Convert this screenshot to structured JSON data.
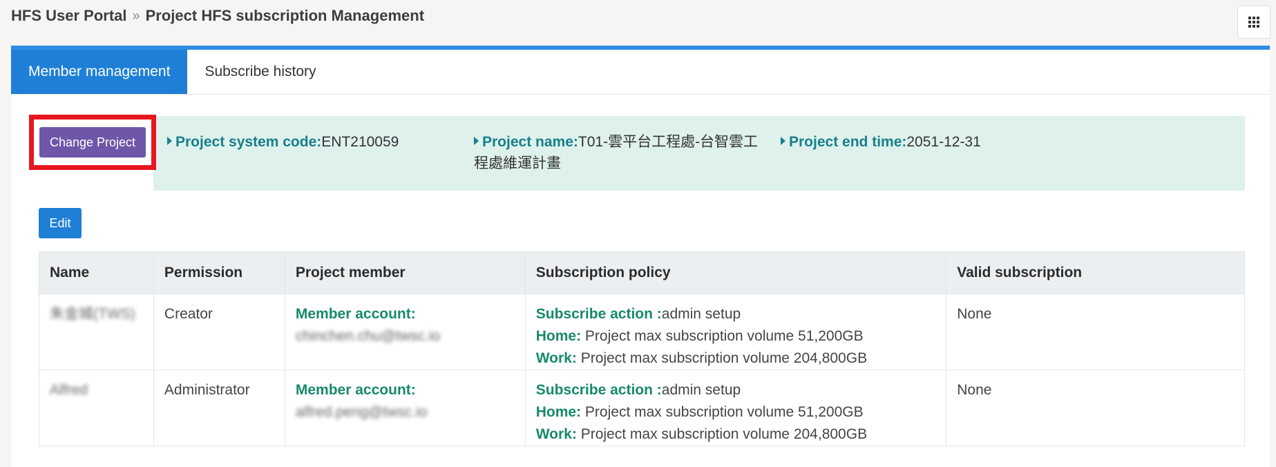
{
  "breadcrumb": {
    "root": "HFS User Portal",
    "separator": "»",
    "current": "Project HFS subscription Management"
  },
  "icons": {
    "apps": "grid-icon",
    "bullet": "caret-right-icon"
  },
  "tabs": [
    {
      "label": "Member management",
      "active": true
    },
    {
      "label": "Subscribe history",
      "active": false
    }
  ],
  "actions": {
    "change_project": "Change Project",
    "edit": "Edit"
  },
  "project": {
    "system_code_label": "Project system code:",
    "system_code": "ENT210059",
    "name_label": "Project name:",
    "name": "T01-雲平台工程處-台智雲工程處維運計畫",
    "end_time_label": "Project end time:",
    "end_time": "2051-12-31"
  },
  "table": {
    "headers": [
      "Name",
      "Permission",
      "Project member",
      "Subscription policy",
      "Valid subscription"
    ],
    "rows": [
      {
        "name": "朱金城(TWS)",
        "permission": "Creator",
        "member_label": "Member account:",
        "member_account": "chinchen.chu@twsc.io",
        "action_label": "Subscribe action :",
        "action": "admin setup",
        "home_label": "Home:",
        "home": "Project max subscription volume 51,200GB",
        "work_label": "Work:",
        "work": "Project max subscription volume 204,800GB",
        "valid": "None"
      },
      {
        "name": "Alfred",
        "permission": "Administrator",
        "member_label": "Member account:",
        "member_account": "alfred.peng@twsc.io",
        "action_label": "Subscribe action :",
        "action": "admin setup",
        "home_label": "Home:",
        "home": "Project max subscription volume 51,200GB",
        "work_label": "Work:",
        "work": "Project max subscription volume 204,800GB",
        "valid": "None"
      }
    ]
  },
  "colors": {
    "accent": "#1f7fd6",
    "purple_button": "#6f56a8",
    "highlight_border": "#e8161e",
    "info_bg": "#dff1ec",
    "label_teal": "#177f8a",
    "label_green": "#178a6a"
  }
}
